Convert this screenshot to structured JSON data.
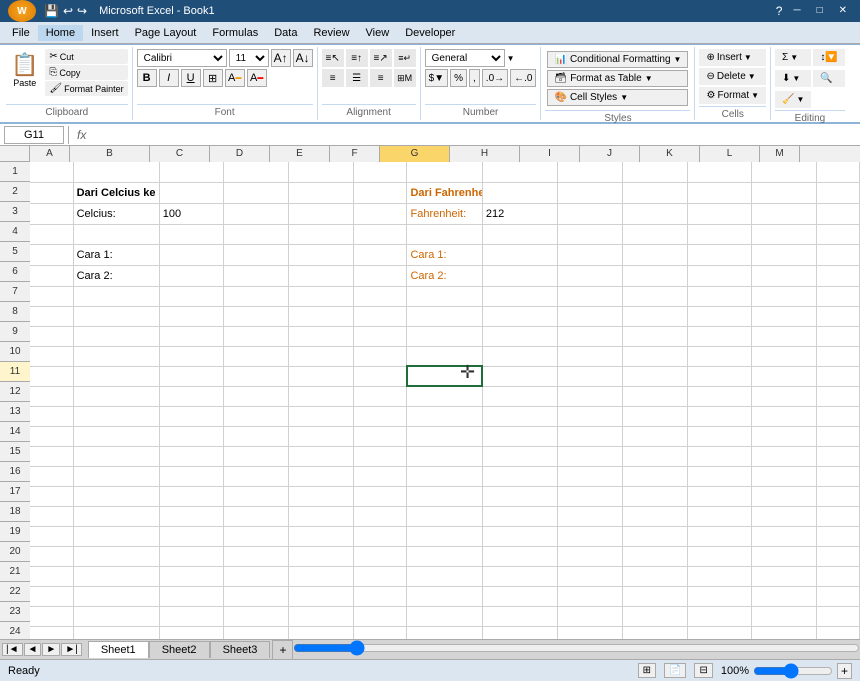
{
  "titlebar": {
    "title": "Microsoft Excel - Book1",
    "minimize": "─",
    "maximize": "□",
    "close": "✕"
  },
  "menubar": {
    "items": [
      "File",
      "Home",
      "Insert",
      "Page Layout",
      "Formulas",
      "Data",
      "Review",
      "View",
      "Developer"
    ]
  },
  "ribbon": {
    "active_tab": "Home",
    "groups": {
      "clipboard": {
        "label": "Clipboard",
        "paste": "Paste"
      },
      "font": {
        "label": "Font",
        "family": "Calibri",
        "size": "11"
      },
      "alignment": {
        "label": "Alignment"
      },
      "number": {
        "label": "Number",
        "format": "General"
      },
      "styles": {
        "label": "Styles",
        "conditional_formatting": "Conditional Formatting",
        "format_as_table": "Format as Table",
        "cell_styles": "Cell Styles"
      },
      "cells": {
        "label": "Cells",
        "insert": "Insert",
        "delete": "Delete",
        "format": "Format"
      },
      "editing": {
        "label": "Editing"
      }
    }
  },
  "formulabar": {
    "name_box": "G11",
    "fx": "fx"
  },
  "columns": [
    "A",
    "B",
    "C",
    "D",
    "E",
    "F",
    "G",
    "H",
    "I",
    "J",
    "K",
    "L",
    "M"
  ],
  "rows": [
    1,
    2,
    3,
    4,
    5,
    6,
    7,
    8,
    9,
    10,
    11,
    12,
    13,
    14,
    15,
    16,
    17,
    18,
    19,
    20,
    21,
    22,
    23,
    24
  ],
  "cells": {
    "B2": {
      "value": "Dari Celcius ke Fahrenheit",
      "bold": true
    },
    "B3": {
      "value": "Celcius:",
      "bold": false
    },
    "C3": {
      "value": "100"
    },
    "G2": {
      "value": "Dari Fahrenheit ke Celcius",
      "bold": true,
      "orange": true
    },
    "G3": {
      "value": "Fahrenheit:",
      "bold": false,
      "orange": true
    },
    "H3": {
      "value": "212"
    },
    "B5": {
      "value": "Cara 1:"
    },
    "B6": {
      "value": "Cara 2:"
    },
    "G5": {
      "value": "Cara 1:",
      "orange": true
    },
    "G6": {
      "value": "Cara 2:",
      "orange": true
    }
  },
  "selected_cell": "G11",
  "sheets": [
    "Sheet1",
    "Sheet2",
    "Sheet3"
  ],
  "active_sheet": "Sheet1",
  "statusbar": {
    "status": "Ready",
    "zoom": "100%"
  }
}
